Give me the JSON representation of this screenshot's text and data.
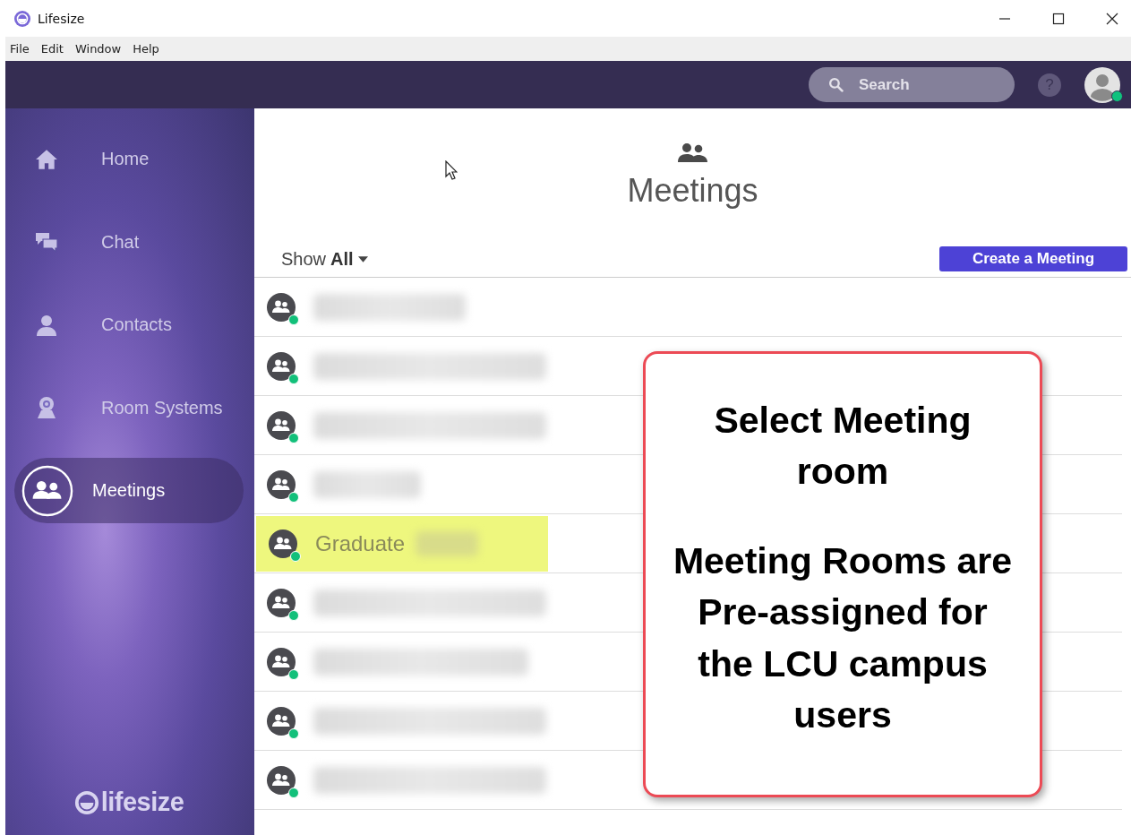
{
  "window": {
    "title": "Lifesize"
  },
  "menu": [
    "File",
    "Edit",
    "Window",
    "Help"
  ],
  "topbar": {
    "search": {
      "placeholder": "Search"
    },
    "help": "?",
    "user_online": true
  },
  "sidebar": {
    "items": [
      {
        "label": "Home",
        "kind": "home",
        "selected": false
      },
      {
        "label": "Chat",
        "kind": "chat",
        "selected": false
      },
      {
        "label": "Contacts",
        "kind": "contact",
        "selected": false
      },
      {
        "label": "Room Systems",
        "kind": "camera",
        "selected": false
      },
      {
        "label": "Meetings",
        "kind": "group",
        "selected": true
      }
    ],
    "logo": "lifesize"
  },
  "page": {
    "title": "Meetings",
    "filter": {
      "label": "Show",
      "value": "All"
    },
    "create_button": "Create a Meeting"
  },
  "rooms": [
    {
      "redacted": true,
      "highlighted": false,
      "online": true
    },
    {
      "redacted": true,
      "highlighted": false,
      "online": true
    },
    {
      "redacted": true,
      "highlighted": false,
      "online": true
    },
    {
      "redacted": true,
      "highlighted": false,
      "online": true
    },
    {
      "name": "Graduate",
      "redacted": true,
      "highlighted": true,
      "online": true
    },
    {
      "redacted": true,
      "highlighted": false,
      "online": true
    },
    {
      "redacted": true,
      "highlighted": false,
      "online": true
    },
    {
      "redacted": true,
      "highlighted": false,
      "online": true
    },
    {
      "redacted": true,
      "highlighted": false,
      "online": true
    }
  ],
  "callout": {
    "paragraphs": [
      "Select Meeting room",
      "Meeting Rooms are Pre-assigned for the LCU campus users"
    ]
  }
}
